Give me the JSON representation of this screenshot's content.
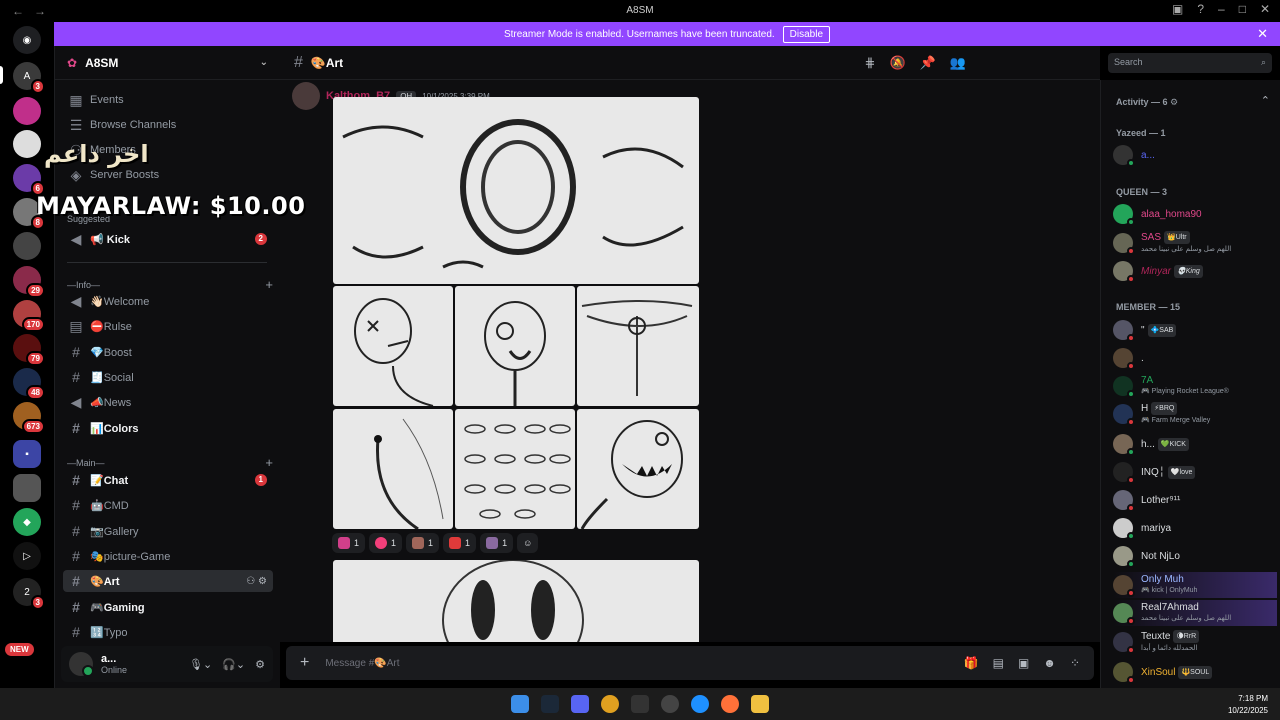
{
  "window": {
    "title": "A8SM",
    "nav_back": "←",
    "nav_forward": "→"
  },
  "banner": {
    "text": "Streamer Mode is enabled. Usernames have been truncated.",
    "button": "Disable"
  },
  "servers": {
    "badges": [
      "3",
      "6",
      "8",
      "29",
      "170",
      "79",
      "48",
      "673",
      "3"
    ],
    "new_label": "NEW"
  },
  "guild": {
    "name": "A8SM"
  },
  "sidebar": {
    "top_items": [
      {
        "label": "Events",
        "icon": "calendar-icon"
      },
      {
        "label": "Browse Channels",
        "icon": "list-icon"
      },
      {
        "label": "Members",
        "icon": "people-icon"
      },
      {
        "label": "Server Boosts",
        "icon": "boost-icon"
      }
    ],
    "suggested_label": "Suggested",
    "suggested": {
      "label": "📢 Kick",
      "badge": "2"
    },
    "cat_info": "—Info—",
    "info_channels": [
      {
        "label": "👋🏻Welcome",
        "icon": "announce"
      },
      {
        "label": "⛔Rulse",
        "icon": "rules"
      },
      {
        "label": "💎Boost",
        "icon": "hash"
      },
      {
        "label": "🧾Social",
        "icon": "hash"
      },
      {
        "label": "📣News",
        "icon": "announce"
      },
      {
        "label": "📊Colors",
        "icon": "hash"
      }
    ],
    "cat_main": "—Main—",
    "main_channels": [
      {
        "label": "📝Chat",
        "badge": "1"
      },
      {
        "label": "🤖CMD"
      },
      {
        "label": "📷Gallery"
      },
      {
        "label": "🎭picture-Game"
      },
      {
        "label": "🎨Art"
      },
      {
        "label": "🎮Gaming"
      },
      {
        "label": "🔢Typo"
      }
    ]
  },
  "user": {
    "name": "a...",
    "status": "Online"
  },
  "channel": {
    "name": "🎨Art"
  },
  "search": {
    "placeholder": "Search"
  },
  "message": {
    "author": "Kalthom_B7",
    "tag": "OH",
    "timestamp": "10/1/2025 3:39 PM"
  },
  "reactions": [
    {
      "count": "1",
      "color": "#d13f8a"
    },
    {
      "count": "1",
      "color": "#f23f7a"
    },
    {
      "count": "1",
      "color": "#a0665a"
    },
    {
      "count": "1",
      "color": "#e03a3a"
    },
    {
      "count": "1",
      "color": "#8a6aa0"
    }
  ],
  "composer": {
    "placeholder": "Message #🎨Art"
  },
  "members": {
    "activity": "Activity — 6 ⚙",
    "group1": "Yazeed — 1",
    "group2": "QUEEN — 3",
    "group3": "MEMBER — 15",
    "yazeed": [
      {
        "name": "a...",
        "color": "#5865f2"
      }
    ],
    "queen": [
      {
        "name": "alaa_homa90",
        "color": "#e0488a",
        "chip": "",
        "sub": ""
      },
      {
        "name": "SAS",
        "color": "#e0488a",
        "chip": "👑Ultr",
        "sub": "اللهم صل وسلم على نبينا محمد"
      },
      {
        "name": "Minyar",
        "color": "#b0265a",
        "chip": "💀King",
        "sub": ""
      }
    ],
    "member": [
      {
        "name": "\"",
        "chip": "💠SAB",
        "sub": "",
        "color": "#dbdee1"
      },
      {
        "name": ".",
        "chip": "",
        "sub": "",
        "color": "#dbdee1"
      },
      {
        "name": "7A",
        "chip": "",
        "sub": "🎮 Playing Rocket League®",
        "color": "#23a55a"
      },
      {
        "name": "H",
        "chip": "⚡BRQ",
        "sub": "🎮 Farm Merge Valley",
        "color": "#dbdee1"
      },
      {
        "name": "h...",
        "chip": "💚KICK",
        "sub": "",
        "color": "#dbdee1"
      },
      {
        "name": "INQ╎",
        "chip": "🤍love",
        "sub": "",
        "color": "#dbdee1"
      },
      {
        "name": "Lother⁹¹¹",
        "chip": "",
        "sub": "",
        "color": "#dbdee1"
      },
      {
        "name": "mariya",
        "chip": "",
        "sub": "",
        "color": "#dbdee1"
      },
      {
        "name": "Not NjLo",
        "chip": "",
        "sub": "",
        "color": "#dbdee1"
      },
      {
        "name": "Only Muh",
        "chip": "",
        "sub": "🎮 kick | OnlyMuh",
        "color": "#9bb7ff"
      },
      {
        "name": "Real7Ahmad",
        "chip": "",
        "sub": "اللهم صل وسلم على نبينا محمد",
        "color": "#dbdee1"
      },
      {
        "name": "Teuxte",
        "chip": "🌘RrR",
        "sub": "الحمدلله دائما و أبدا",
        "color": "#dbdee1"
      },
      {
        "name": "XinSoul",
        "chip": "🔱SOUL",
        "sub": "",
        "color": "#f0b232"
      }
    ]
  },
  "overlay": {
    "arabic": "اخر داعم",
    "donation": "MAYARLAW: $10.00"
  },
  "clock": {
    "time": "7:18 PM",
    "date": "10/22/2025"
  }
}
